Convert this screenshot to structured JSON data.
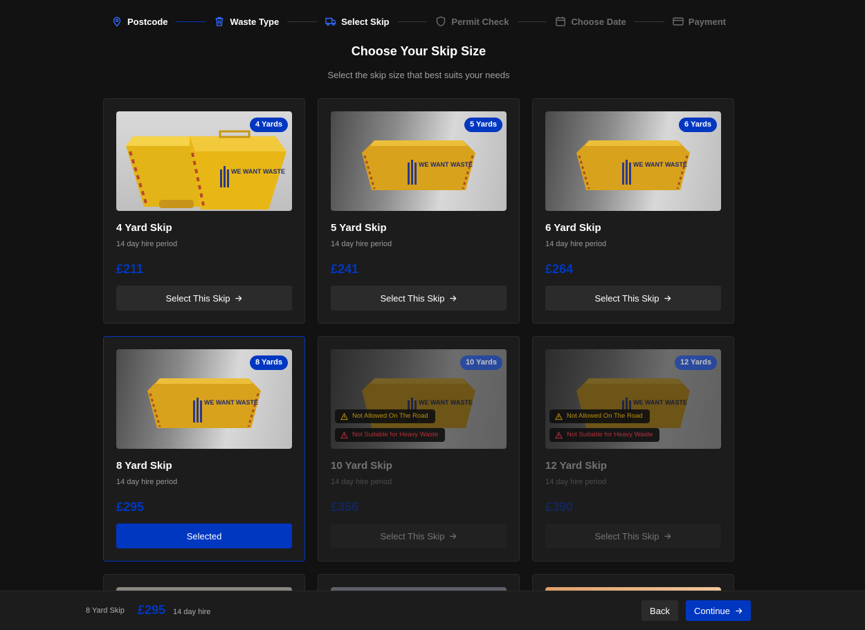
{
  "stepper": [
    {
      "label": "Postcode",
      "icon": "map-pin-icon",
      "state": "done"
    },
    {
      "label": "Waste Type",
      "icon": "trash-icon",
      "state": "done"
    },
    {
      "label": "Select Skip",
      "icon": "truck-icon",
      "state": "done"
    },
    {
      "label": "Permit Check",
      "icon": "shield-icon",
      "state": "todo"
    },
    {
      "label": "Choose Date",
      "icon": "calendar-icon",
      "state": "todo"
    },
    {
      "label": "Payment",
      "icon": "credit-card-icon",
      "state": "todo"
    }
  ],
  "heading": {
    "title": "Choose Your Skip Size",
    "subtitle": "Select the skip size that best suits your needs"
  },
  "skips": [
    {
      "badge": "4 Yards",
      "name": "4 Yard Skip",
      "period": "14 day hire period",
      "price": "£211",
      "button": "Select This Skip",
      "state": "default",
      "warnings": []
    },
    {
      "badge": "5 Yards",
      "name": "5 Yard Skip",
      "period": "14 day hire period",
      "price": "£241",
      "button": "Select This Skip",
      "state": "default",
      "warnings": []
    },
    {
      "badge": "6 Yards",
      "name": "6 Yard Skip",
      "period": "14 day hire period",
      "price": "£264",
      "button": "Select This Skip",
      "state": "default",
      "warnings": []
    },
    {
      "badge": "8 Yards",
      "name": "8 Yard Skip",
      "period": "14 day hire period",
      "price": "£295",
      "button": "Selected",
      "state": "selected",
      "warnings": []
    },
    {
      "badge": "10 Yards",
      "name": "10 Yard Skip",
      "period": "14 day hire period",
      "price": "£356",
      "button": "Select This Skip",
      "state": "disabled",
      "warnings": [
        "Not Allowed On The Road",
        "Not Suitable for Heavy Waste"
      ]
    },
    {
      "badge": "12 Yards",
      "name": "12 Yard Skip",
      "period": "14 day hire period",
      "price": "£390",
      "button": "Select This Skip",
      "state": "disabled",
      "warnings": [
        "Not Allowed On The Road",
        "Not Suitable for Heavy Waste"
      ]
    }
  ],
  "skip_logo_text": "WE WANT WASTE",
  "bottom_bar": {
    "name": "8 Yard Skip",
    "price": "£295",
    "period": "14 day hire",
    "back": "Back",
    "continue": "Continue"
  },
  "colors": {
    "accent": "#0037c1",
    "background": "#121212",
    "card": "#1c1c1c",
    "warning_road": "#b7900f",
    "warning_heavy": "#b5303a",
    "skip_yellow": "#e2ae16"
  }
}
